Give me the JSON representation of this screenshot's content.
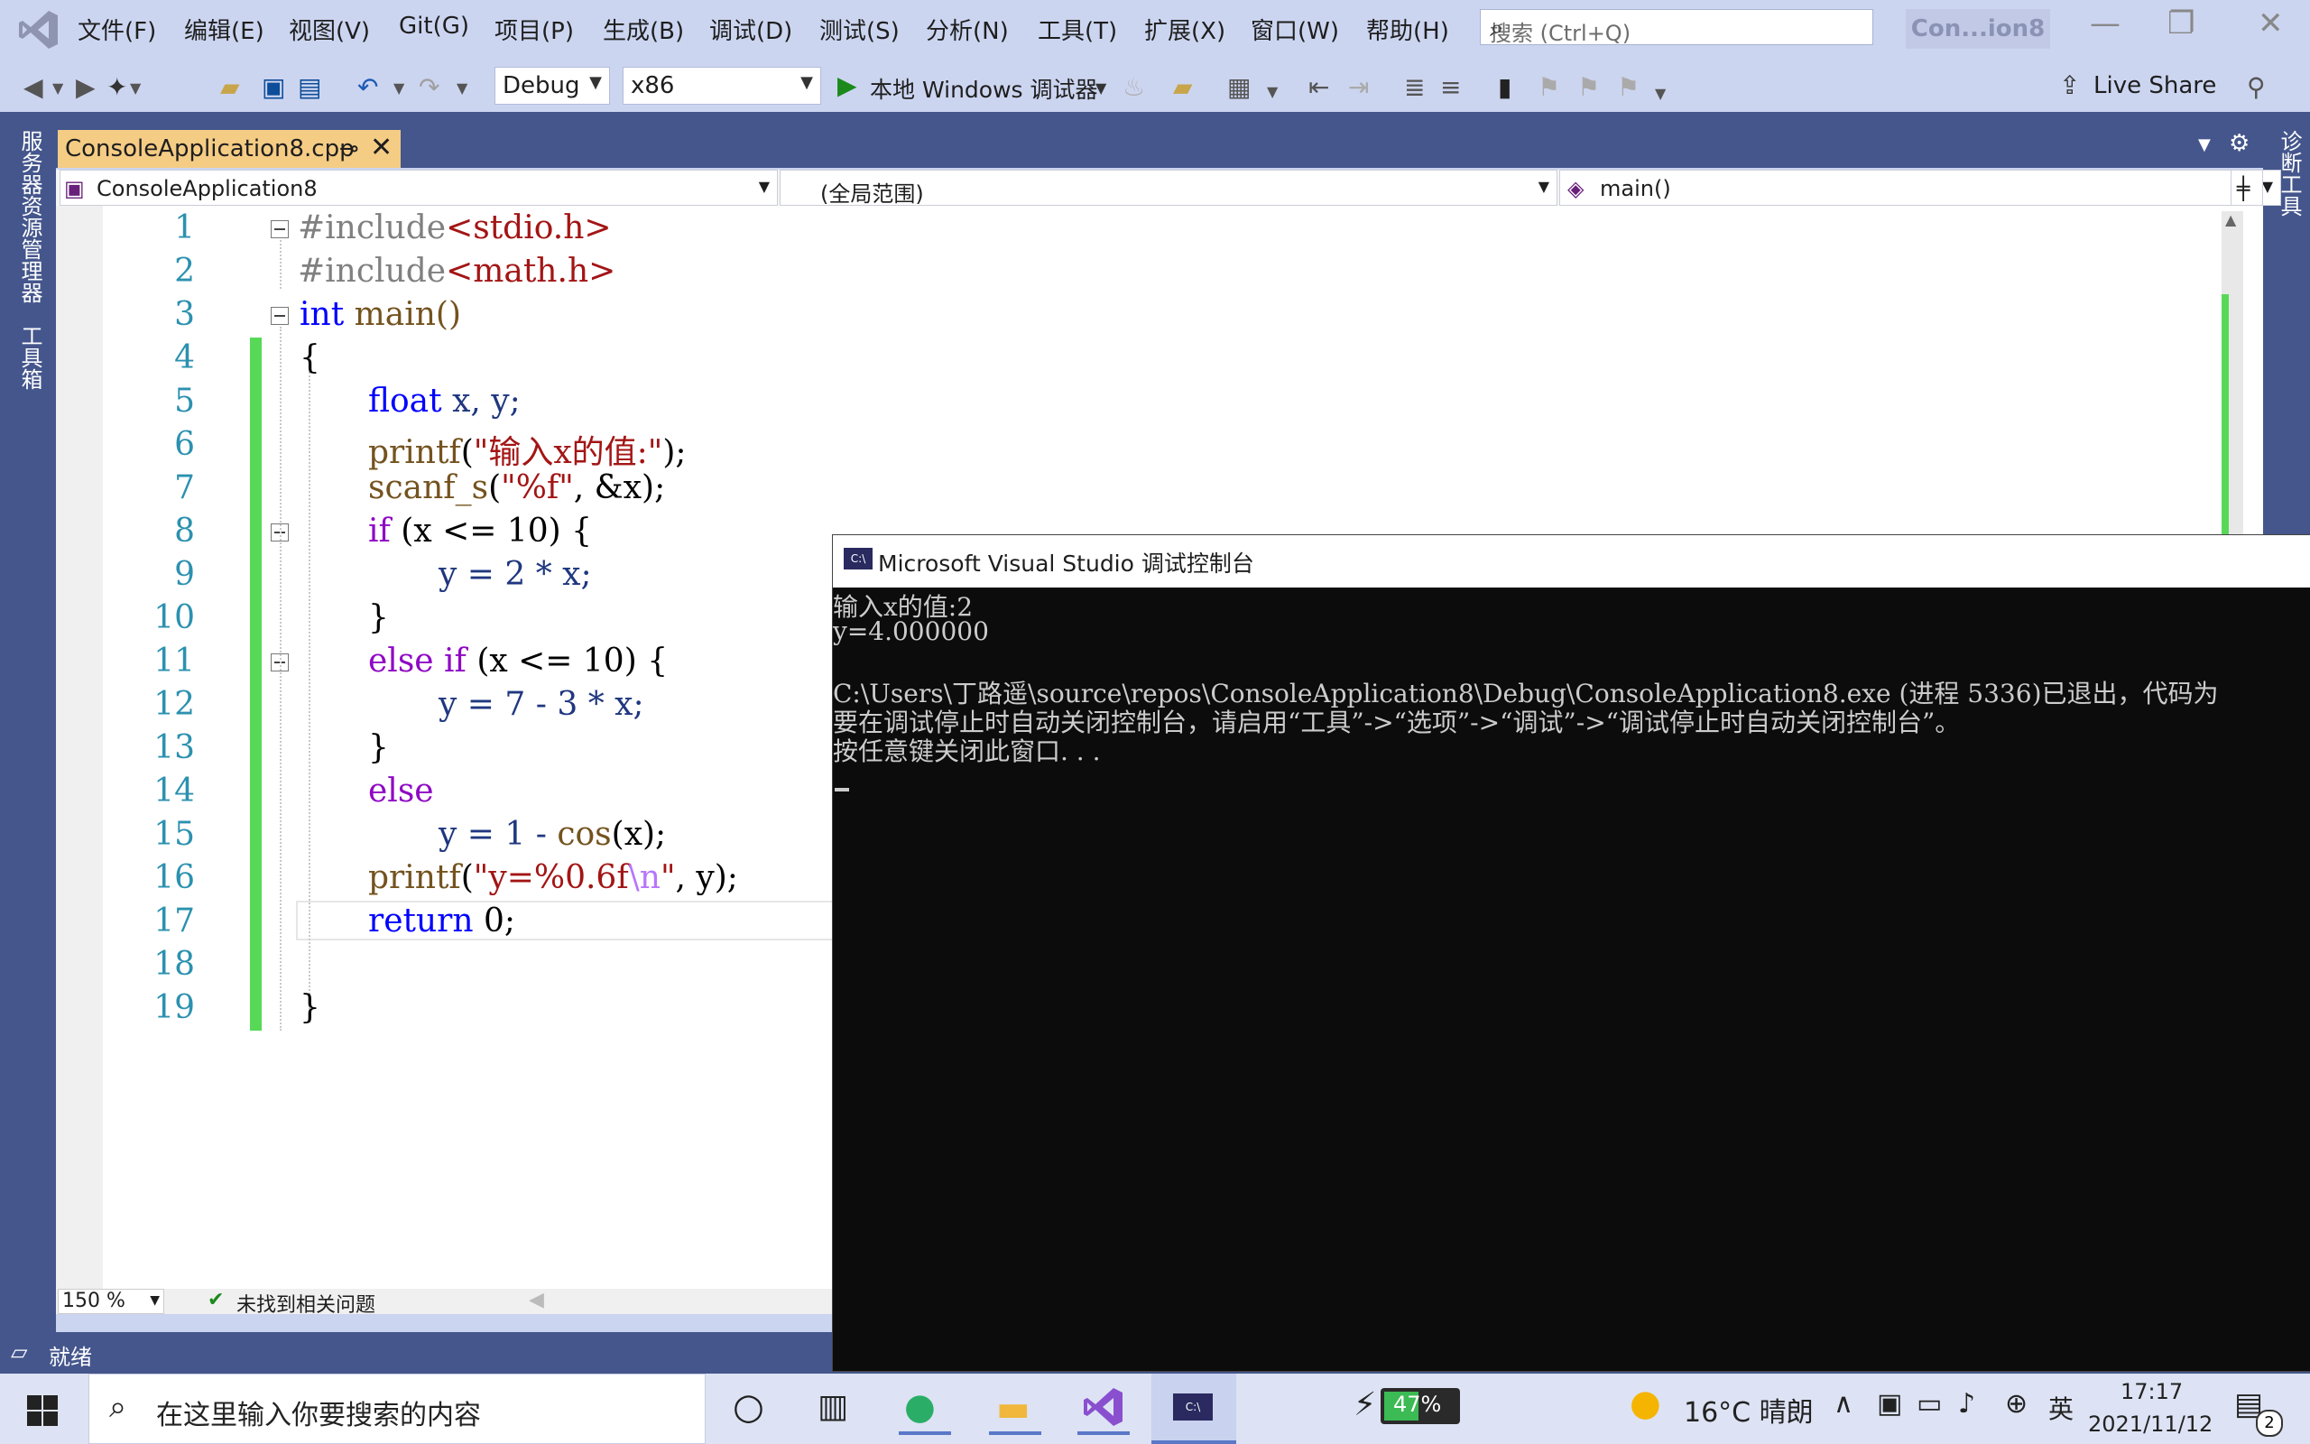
{
  "menu": [
    "文件(F)",
    "编辑(E)",
    "视图(V)",
    "Git(G)",
    "项目(P)",
    "生成(B)",
    "调试(D)",
    "测试(S)",
    "分析(N)",
    "工具(T)",
    "扩展(X)",
    "窗口(W)",
    "帮助(H)"
  ],
  "search": {
    "placeholder": "搜索 (Ctrl+Q)"
  },
  "solution_badge": "Con...ion8",
  "toolbar": {
    "config": "Debug",
    "platform": "x86",
    "run_label": "本地 Windows 调试器",
    "live_share": "Live Share"
  },
  "side_panels": {
    "left_1": "服务器资源管理器",
    "left_2": "工具箱",
    "right_1": "诊断工具"
  },
  "tab": {
    "filename": "ConsoleApplication8.cpp",
    "pin": "⊸",
    "close": "✕"
  },
  "nav": {
    "project": "ConsoleApplication8",
    "scope": "(全局范围)",
    "member": "main()"
  },
  "code_lines": [
    {
      "n": "1"
    },
    {
      "n": "2"
    },
    {
      "n": "3"
    },
    {
      "n": "4"
    },
    {
      "n": "5"
    },
    {
      "n": "6"
    },
    {
      "n": "7"
    },
    {
      "n": "8"
    },
    {
      "n": "9"
    },
    {
      "n": "10"
    },
    {
      "n": "11"
    },
    {
      "n": "12"
    },
    {
      "n": "13"
    },
    {
      "n": "14"
    },
    {
      "n": "15"
    },
    {
      "n": "16"
    },
    {
      "n": "17"
    },
    {
      "n": "18"
    },
    {
      "n": "19"
    }
  ],
  "code": {
    "l1_a": "#include",
    "l1_b": "<stdio.h>",
    "l2_a": "#include",
    "l2_b": "<math.h>",
    "l3_a": "int",
    "l3_b": " main()",
    "l4": "{",
    "l5_a": "float",
    "l5_b": " x, y;",
    "l6_a": "printf",
    "l6_b": "(",
    "l6_c": "\"输入x的值:\"",
    "l6_d": ");",
    "l7_a": "scanf_s",
    "l7_b": "(",
    "l7_c": "\"%f\"",
    "l7_d": ", &x);",
    "l8_a": "if",
    "l8_b": " (x <= 10) {",
    "l9": "y = 2 * x;",
    "l10": "}",
    "l11_a": "else if",
    "l11_b": " (x <= 10) {",
    "l12": "y = 7 - 3 * x;",
    "l13": "}",
    "l14": "else",
    "l15_a": "y = 1 - ",
    "l15_b": "cos",
    "l15_c": "(x);",
    "l16_a": "printf",
    "l16_b": "(",
    "l16_c": "\"y=%0.6f",
    "l16_d": "\\n",
    "l16_e": "\"",
    "l16_f": ", y);",
    "l17_a": "return",
    "l17_b": " 0;",
    "l19": "}"
  },
  "status": {
    "zoom": "150 %",
    "issues": "未找到相关问题",
    "ready": "就绪"
  },
  "console": {
    "title": "Microsoft Visual Studio 调试控制台",
    "lines": [
      "输入x的值:2",
      "y=4.000000",
      "",
      "C:\\Users\\丁路遥\\source\\repos\\ConsoleApplication8\\Debug\\ConsoleApplication8.exe (进程 5336)已退出，代码为",
      "要在调试停止时自动关闭控制台，请启用“工具”->“选项”->“调试”->“调试停止时自动关闭控制台”。",
      "按任意键关闭此窗口. . ."
    ]
  },
  "taskbar": {
    "search_placeholder": "在这里输入你要搜索的内容",
    "battery": "47%",
    "weather": "16°C 晴朗",
    "ime": "英",
    "time": "17:17",
    "date": "2021/11/12",
    "notification_count": "2"
  },
  "colors": {
    "accent": "#44568c",
    "tab_active": "#f5cc84",
    "vs_purple": "#68217a",
    "change_bar": "#57d957"
  }
}
